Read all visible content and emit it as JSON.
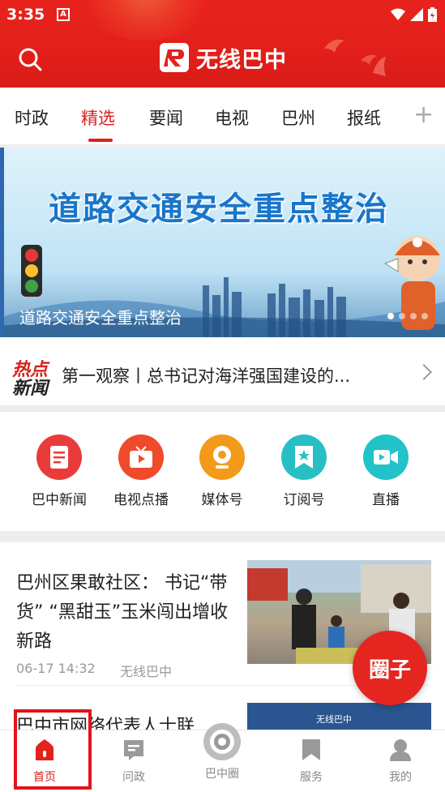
{
  "status": {
    "time": "3:35",
    "notif_badge": "A"
  },
  "header": {
    "app_title": "无线巴中",
    "search_icon": "search-icon",
    "brand_color": "#e2221c"
  },
  "tabs": {
    "items": [
      "时政",
      "精选",
      "要闻",
      "电视",
      "巴州",
      "报纸"
    ],
    "active": "精选",
    "add_icon": "plus-icon"
  },
  "banner": {
    "headline": "道路交通安全重点整治",
    "caption": "道路交通安全重点整治",
    "slide_count": 4,
    "active_slide": 1
  },
  "hot": {
    "logo_top": "热点",
    "logo_bottom": "新闻",
    "text": "第一观察丨总书记对海洋强国建设的..."
  },
  "quick": {
    "items": [
      {
        "label": "巴中新闻",
        "icon": "news-icon",
        "color": "#ea3b3b"
      },
      {
        "label": "电视点播",
        "icon": "tv-icon",
        "color": "#f04a2a"
      },
      {
        "label": "媒体号",
        "icon": "webcam-icon",
        "color": "#f39a1a"
      },
      {
        "label": "订阅号",
        "icon": "bookmark-star-icon",
        "color": "#27bfc4"
      },
      {
        "label": "直播",
        "icon": "video-camera-icon",
        "color": "#22c2c9"
      }
    ]
  },
  "articles": [
    {
      "title": "巴州区果敢社区： 书记“带货” “黑甜玉”玉米闯出增收新路",
      "time": "06-17 14:32",
      "source": "无线巴中"
    },
    {
      "title": "巴中市网络代表人士联",
      "thumb_text": "无线巴中"
    }
  ],
  "floating": {
    "label": "圈子"
  },
  "bottom_nav": {
    "items": [
      {
        "label": "首页",
        "icon": "home-icon"
      },
      {
        "label": "问政",
        "icon": "message-icon"
      },
      {
        "label": "巴中圈",
        "icon": "camera-lens-icon"
      },
      {
        "label": "服务",
        "icon": "bookmark-icon"
      },
      {
        "label": "我的",
        "icon": "user-icon"
      }
    ],
    "active": "首页"
  }
}
